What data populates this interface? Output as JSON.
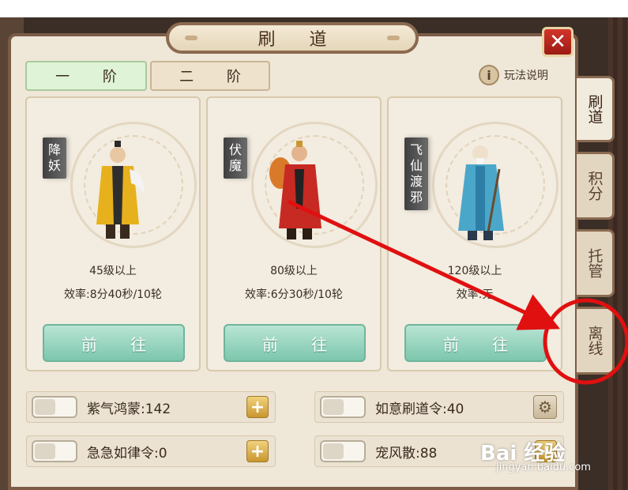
{
  "window": {
    "title": "刷 道"
  },
  "tabs": [
    {
      "label": "一 阶",
      "active": true
    },
    {
      "label": "二 阶",
      "active": false
    }
  ],
  "help": {
    "label": "玩法说明",
    "icon": "info-icon"
  },
  "side_tabs": [
    {
      "label": "刷道",
      "active": true
    },
    {
      "label": "积分",
      "active": false
    },
    {
      "label": "托管",
      "active": false
    },
    {
      "label": "离线",
      "active": false
    }
  ],
  "cards": [
    {
      "name": "降妖",
      "level": "45级以上",
      "efficiency": "效率:8分40秒/10轮",
      "button": "前 往"
    },
    {
      "name": "伏魔",
      "level": "80级以上",
      "efficiency": "效率:6分30秒/10轮",
      "button": "前 往"
    },
    {
      "name": "飞仙渡邪",
      "level": "120级以上",
      "efficiency": "效率:无",
      "button": "前 往"
    }
  ],
  "items": [
    {
      "label": "紫气鸿蒙:142",
      "action": "plus-icon"
    },
    {
      "label": "如意刷道令:40",
      "action": "gear-icon"
    },
    {
      "label": "急急如律令:0",
      "action": "plus-icon"
    },
    {
      "label": "宠风散:88",
      "action": "plus-icon"
    }
  ],
  "watermark": {
    "brand": "Bai 经验",
    "url": "jingyan.baidu.com"
  },
  "colors": {
    "accent_green": "#7cc7ad",
    "close_red": "#c62f24",
    "annotation_red": "#e01010"
  }
}
